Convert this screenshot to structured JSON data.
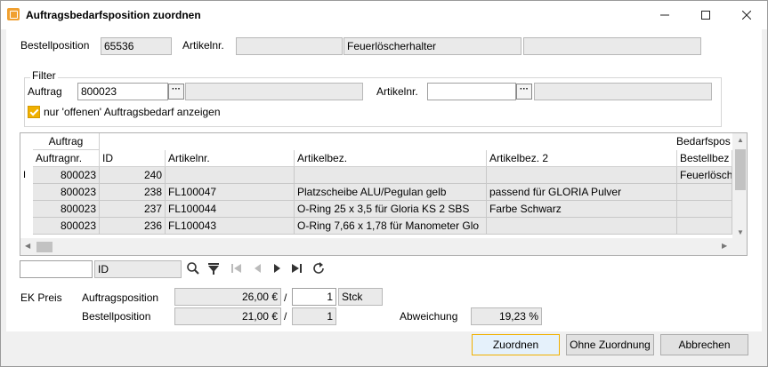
{
  "window": {
    "title": "Auftragsbedarfsposition zuordnen",
    "icon": "app-icon"
  },
  "header": {
    "bestellposition_label": "Bestellposition",
    "bestellposition_value": "65536",
    "artikelnr_label": "Artikelnr.",
    "artikelnr_value": "",
    "artikelbez_value": "Feuerlöscherhalter",
    "artikelbez2_value": ""
  },
  "filter": {
    "legend": "Filter",
    "auftrag_label": "Auftrag",
    "auftrag_value": "800023",
    "auftrag_desc": "",
    "artikelnr_label": "Artikelnr.",
    "artikelnr_value": "",
    "artikelnr_desc": "",
    "checkbox_label": "nur 'offenen' Auftragsbedarf anzeigen",
    "checkbox_checked": true,
    "lookup_button": "···"
  },
  "grid": {
    "group_headers": {
      "auftrag": "Auftrag",
      "bedarfsposition": "Bedarfspos"
    },
    "columns": [
      "Auftragnr.",
      "ID",
      "Artikelnr.",
      "Artikelbez.",
      "Artikelbez. 2",
      "Bestellbez"
    ],
    "rows": [
      {
        "auftragnr": "800023",
        "id": "240",
        "artikelnr": "",
        "artikelbez": "",
        "artikelbez2": "",
        "bestellbez": "Feuerlösch"
      },
      {
        "auftragnr": "800023",
        "id": "238",
        "artikelnr": "FL100047",
        "artikelbez": "Platzscheibe ALU/Pegulan gelb",
        "artikelbez2": "passend für GLORIA Pulver",
        "bestellbez": ""
      },
      {
        "auftragnr": "800023",
        "id": "237",
        "artikelnr": "FL100044",
        "artikelbez": "O-Ring 25 x 3,5 für Gloria KS 2 SBS",
        "artikelbez2": "Farbe Schwarz",
        "bestellbez": ""
      },
      {
        "auftragnr": "800023",
        "id": "236",
        "artikelnr": "FL100043",
        "artikelbez": "O-Ring 7,66 x 1,78 für Manometer Glo",
        "artikelbez2": "",
        "bestellbez": ""
      }
    ],
    "row_cursor": "I"
  },
  "search": {
    "value": "",
    "column": "ID"
  },
  "ek": {
    "label": "EK Preis",
    "auftragsposition_label": "Auftragsposition",
    "auftragsposition_price": "26,00 €",
    "auftragsposition_qty": "1",
    "unit": "Stck",
    "bestellposition_label": "Bestellposition",
    "bestellposition_price": "21,00 €",
    "bestellposition_qty": "1",
    "slash": "/",
    "abweichung_label": "Abweichung",
    "abweichung_value": "19,23 %"
  },
  "buttons": {
    "zuordnen": "Zuordnen",
    "ohne": "Ohne Zuordnung",
    "abbrechen": "Abbrechen"
  },
  "colors": {
    "accent": "#f0b000",
    "field_bg": "#eaeaea",
    "row_bg": "#e8e8e8"
  }
}
